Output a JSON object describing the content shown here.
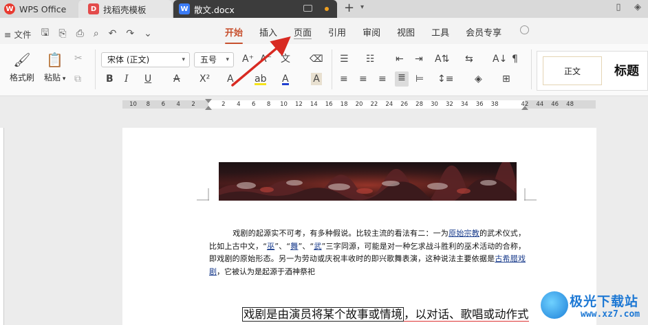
{
  "tabs": {
    "app": "WPS Office",
    "templates": "找稻壳模板",
    "document": "散文.docx"
  },
  "menu": {
    "file": "文件",
    "tabs": [
      "开始",
      "插入",
      "页面",
      "引用",
      "审阅",
      "视图",
      "工具",
      "会员专享"
    ],
    "active_tab": "开始"
  },
  "ribbon": {
    "format_painter": "格式刷",
    "paste": "粘贴",
    "font_name": "宋体 (正文)",
    "font_size": "五号",
    "style_normal": "正文",
    "style_title": "标题"
  },
  "ruler": {
    "ticks_left": [
      "10",
      "8",
      "6",
      "4",
      "2"
    ],
    "ticks_right": [
      "2",
      "4",
      "6",
      "8",
      "10",
      "12",
      "14",
      "16",
      "18",
      "20",
      "22",
      "24",
      "26",
      "28",
      "30",
      "32",
      "34",
      "36",
      "38"
    ],
    "ticks_far": [
      "42",
      "44",
      "46",
      "48"
    ]
  },
  "document": {
    "p1_a": "戏剧的起源实不可考，有多种假说。比较主流的看法有二：一为",
    "p1_link1": "原始宗教",
    "p1_b": "的武术仪式，比如上古中文，“",
    "p1_link2": "巫",
    "p1_c": "”、“",
    "p1_link3": "舞",
    "p1_d": "”、“",
    "p1_link4": "武",
    "p1_e": "”三字同源，可能是对一种乞求战斗胜利的巫术活动的合称，即戏剧的原始形态。另一为劳动或庆祝丰收时的即兴歌舞表演，这种说法主要依据是",
    "p1_link5": "古希腊戏剧",
    "p1_f": "，它被认为是起源于酒神祭祀",
    "line2_boxed": "戏剧是由演员将某个故事或情境",
    "line2_rest": "，以对话、歌唱或动作式"
  },
  "watermark": {
    "brand": "极光下载站",
    "url": "www.xz7.com"
  }
}
